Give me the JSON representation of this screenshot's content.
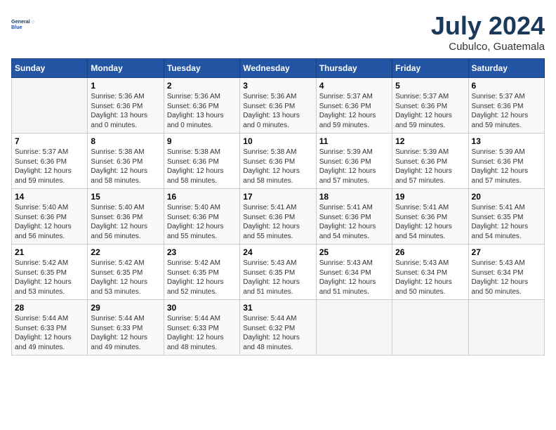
{
  "header": {
    "logo_line1": "General",
    "logo_line2": "Blue",
    "month_year": "July 2024",
    "location": "Cubulco, Guatemala"
  },
  "days_of_week": [
    "Sunday",
    "Monday",
    "Tuesday",
    "Wednesday",
    "Thursday",
    "Friday",
    "Saturday"
  ],
  "weeks": [
    [
      {
        "day": "",
        "sunrise": "",
        "sunset": "",
        "daylight": ""
      },
      {
        "day": "1",
        "sunrise": "5:36 AM",
        "sunset": "6:36 PM",
        "daylight": "13 hours and 0 minutes."
      },
      {
        "day": "2",
        "sunrise": "5:36 AM",
        "sunset": "6:36 PM",
        "daylight": "13 hours and 0 minutes."
      },
      {
        "day": "3",
        "sunrise": "5:36 AM",
        "sunset": "6:36 PM",
        "daylight": "13 hours and 0 minutes."
      },
      {
        "day": "4",
        "sunrise": "5:37 AM",
        "sunset": "6:36 PM",
        "daylight": "12 hours and 59 minutes."
      },
      {
        "day": "5",
        "sunrise": "5:37 AM",
        "sunset": "6:36 PM",
        "daylight": "12 hours and 59 minutes."
      },
      {
        "day": "6",
        "sunrise": "5:37 AM",
        "sunset": "6:36 PM",
        "daylight": "12 hours and 59 minutes."
      }
    ],
    [
      {
        "day": "7",
        "sunrise": "5:37 AM",
        "sunset": "6:36 PM",
        "daylight": "12 hours and 59 minutes."
      },
      {
        "day": "8",
        "sunrise": "5:38 AM",
        "sunset": "6:36 PM",
        "daylight": "12 hours and 58 minutes."
      },
      {
        "day": "9",
        "sunrise": "5:38 AM",
        "sunset": "6:36 PM",
        "daylight": "12 hours and 58 minutes."
      },
      {
        "day": "10",
        "sunrise": "5:38 AM",
        "sunset": "6:36 PM",
        "daylight": "12 hours and 58 minutes."
      },
      {
        "day": "11",
        "sunrise": "5:39 AM",
        "sunset": "6:36 PM",
        "daylight": "12 hours and 57 minutes."
      },
      {
        "day": "12",
        "sunrise": "5:39 AM",
        "sunset": "6:36 PM",
        "daylight": "12 hours and 57 minutes."
      },
      {
        "day": "13",
        "sunrise": "5:39 AM",
        "sunset": "6:36 PM",
        "daylight": "12 hours and 57 minutes."
      }
    ],
    [
      {
        "day": "14",
        "sunrise": "5:40 AM",
        "sunset": "6:36 PM",
        "daylight": "12 hours and 56 minutes."
      },
      {
        "day": "15",
        "sunrise": "5:40 AM",
        "sunset": "6:36 PM",
        "daylight": "12 hours and 56 minutes."
      },
      {
        "day": "16",
        "sunrise": "5:40 AM",
        "sunset": "6:36 PM",
        "daylight": "12 hours and 55 minutes."
      },
      {
        "day": "17",
        "sunrise": "5:41 AM",
        "sunset": "6:36 PM",
        "daylight": "12 hours and 55 minutes."
      },
      {
        "day": "18",
        "sunrise": "5:41 AM",
        "sunset": "6:36 PM",
        "daylight": "12 hours and 54 minutes."
      },
      {
        "day": "19",
        "sunrise": "5:41 AM",
        "sunset": "6:36 PM",
        "daylight": "12 hours and 54 minutes."
      },
      {
        "day": "20",
        "sunrise": "5:41 AM",
        "sunset": "6:35 PM",
        "daylight": "12 hours and 54 minutes."
      }
    ],
    [
      {
        "day": "21",
        "sunrise": "5:42 AM",
        "sunset": "6:35 PM",
        "daylight": "12 hours and 53 minutes."
      },
      {
        "day": "22",
        "sunrise": "5:42 AM",
        "sunset": "6:35 PM",
        "daylight": "12 hours and 53 minutes."
      },
      {
        "day": "23",
        "sunrise": "5:42 AM",
        "sunset": "6:35 PM",
        "daylight": "12 hours and 52 minutes."
      },
      {
        "day": "24",
        "sunrise": "5:43 AM",
        "sunset": "6:35 PM",
        "daylight": "12 hours and 51 minutes."
      },
      {
        "day": "25",
        "sunrise": "5:43 AM",
        "sunset": "6:34 PM",
        "daylight": "12 hours and 51 minutes."
      },
      {
        "day": "26",
        "sunrise": "5:43 AM",
        "sunset": "6:34 PM",
        "daylight": "12 hours and 50 minutes."
      },
      {
        "day": "27",
        "sunrise": "5:43 AM",
        "sunset": "6:34 PM",
        "daylight": "12 hours and 50 minutes."
      }
    ],
    [
      {
        "day": "28",
        "sunrise": "5:44 AM",
        "sunset": "6:33 PM",
        "daylight": "12 hours and 49 minutes."
      },
      {
        "day": "29",
        "sunrise": "5:44 AM",
        "sunset": "6:33 PM",
        "daylight": "12 hours and 49 minutes."
      },
      {
        "day": "30",
        "sunrise": "5:44 AM",
        "sunset": "6:33 PM",
        "daylight": "12 hours and 48 minutes."
      },
      {
        "day": "31",
        "sunrise": "5:44 AM",
        "sunset": "6:32 PM",
        "daylight": "12 hours and 48 minutes."
      },
      {
        "day": "",
        "sunrise": "",
        "sunset": "",
        "daylight": ""
      },
      {
        "day": "",
        "sunrise": "",
        "sunset": "",
        "daylight": ""
      },
      {
        "day": "",
        "sunrise": "",
        "sunset": "",
        "daylight": ""
      }
    ]
  ]
}
